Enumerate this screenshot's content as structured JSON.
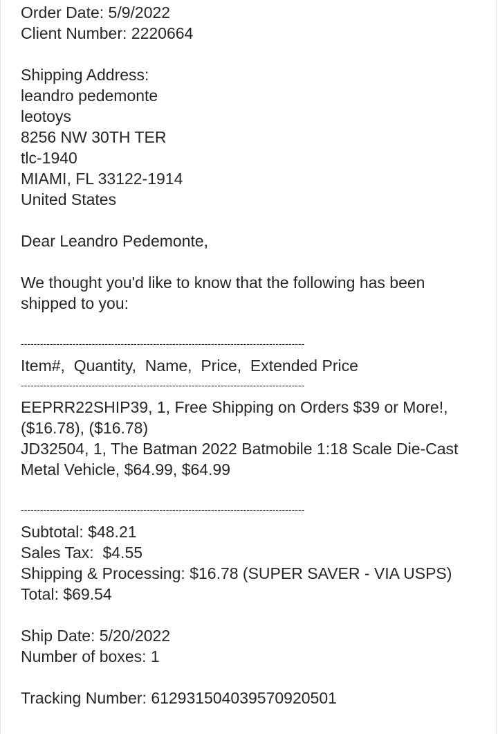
{
  "order": {
    "order_date": "Order Date: 5/9/2022",
    "client_number": "Client Number: 2220664"
  },
  "shipping": {
    "heading": "Shipping Address:",
    "name": "leandro pedemonte",
    "company": "leotoys",
    "street": "8256 NW 30TH TER",
    "unit": "tlc-1940",
    "city_line": "MIAMI, FL 33122-1914",
    "country": "United States"
  },
  "greeting": "Dear Leandro Pedemonte,",
  "intro": "We thought you'd like to know that the following has been shipped to you:",
  "divider": "----------------------------------------------------------------------------------------",
  "table": {
    "header": "Item#,  Quantity,  Name,  Price,  Extended Price",
    "items": [
      "EEPRR22SHIP39,  1,  Free Shipping on Orders $39 or More!,  ($16.78),  ($16.78)",
      "JD32504,  1,  The Batman 2022 Batmobile 1:18 Scale Die-Cast Metal Vehicle,  $64.99,  $64.99"
    ]
  },
  "totals": {
    "subtotal": "Subtotal: $48.21",
    "sales_tax": "Sales Tax:  $4.55",
    "shipping": "Shipping & Processing: $16.78 (SUPER SAVER - VIA USPS)",
    "total": "Total: $69.54"
  },
  "shipment": {
    "ship_date": "Ship Date: 5/20/2022",
    "boxes": "Number of boxes: 1",
    "tracking": "Tracking Number: 612931504039570920501"
  }
}
